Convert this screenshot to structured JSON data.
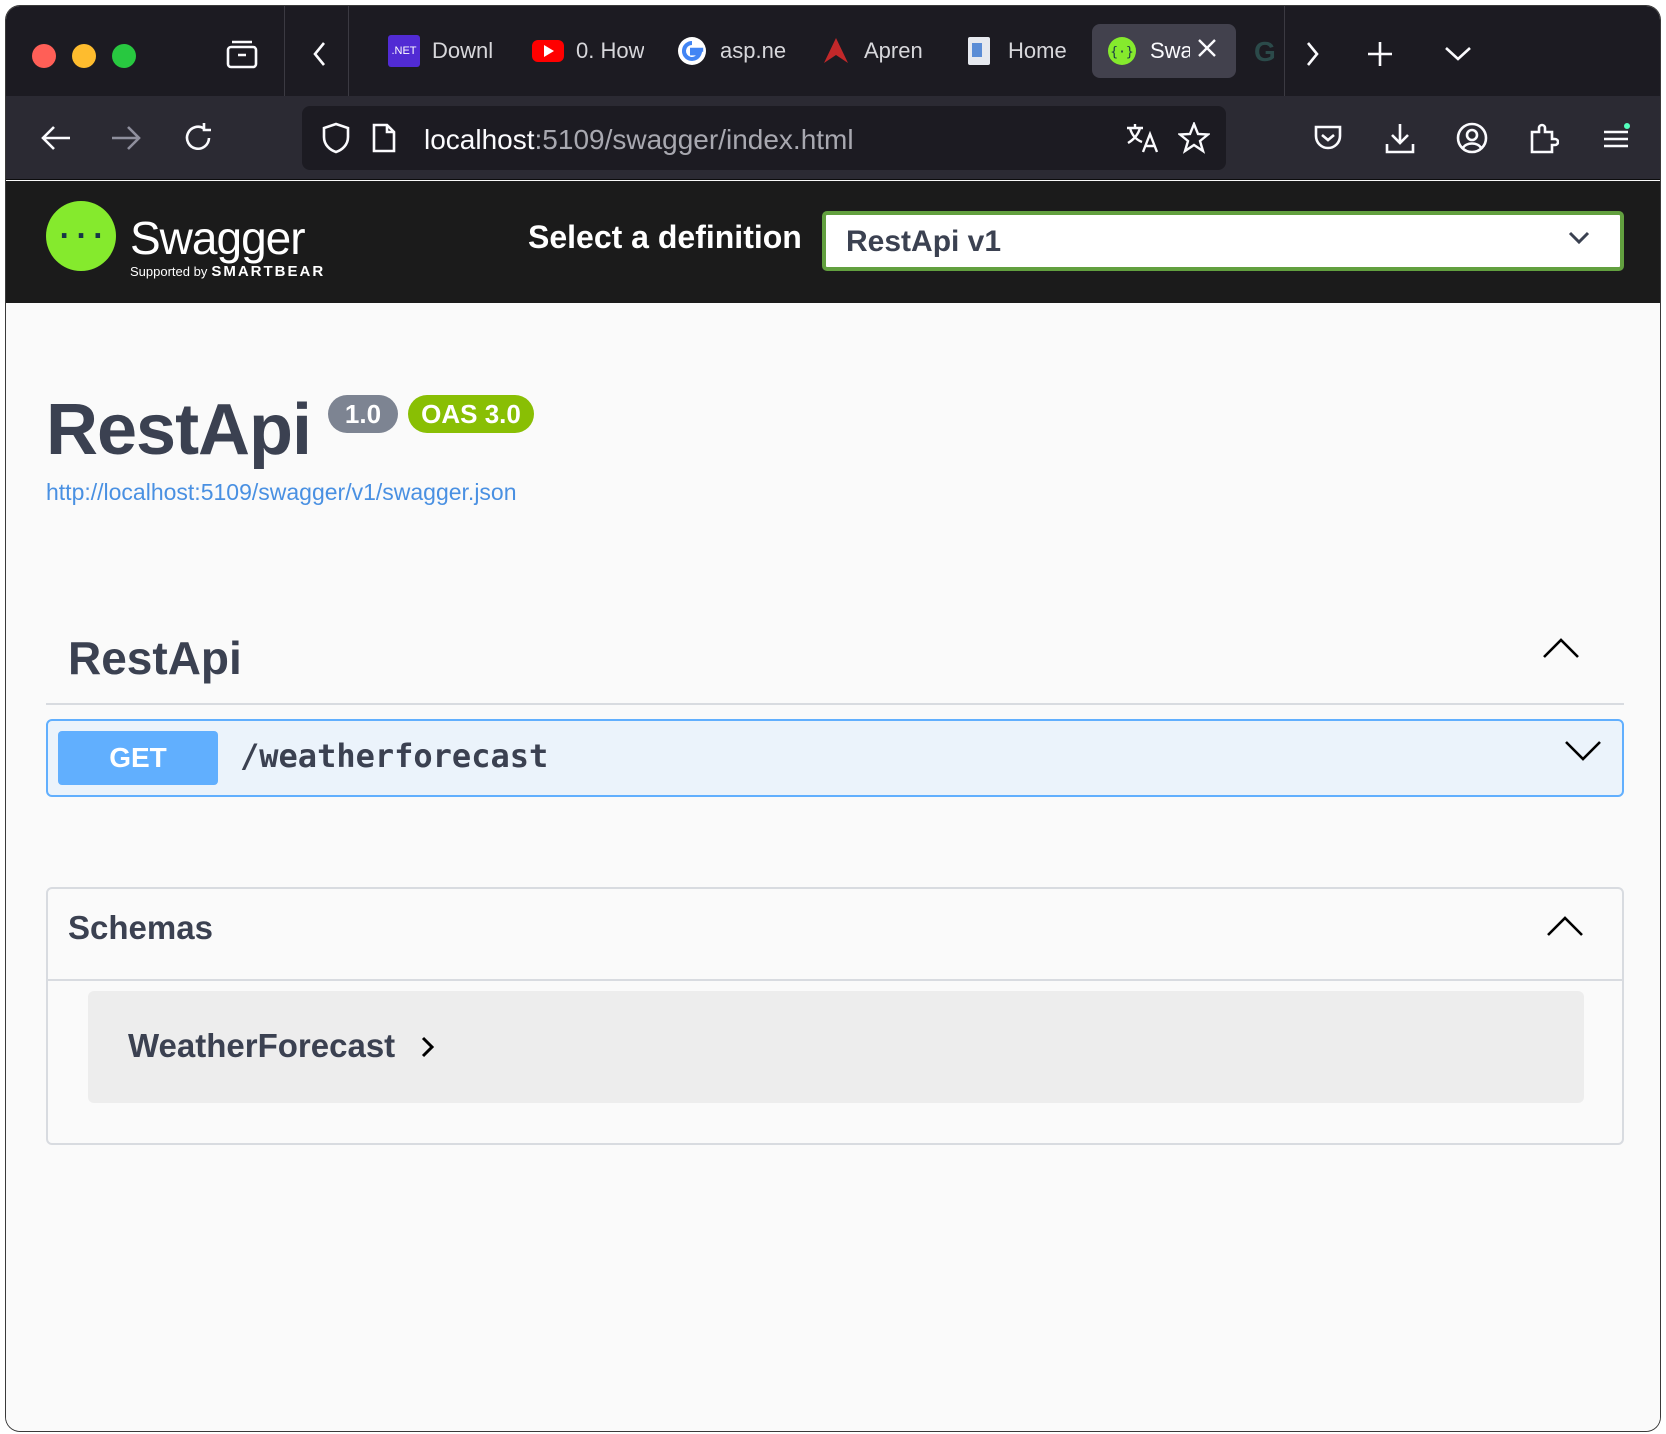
{
  "browser": {
    "tabs": [
      {
        "label": "Downl",
        "icon": "dotnet-icon",
        "active": false
      },
      {
        "label": "0. How",
        "icon": "youtube-icon",
        "active": false
      },
      {
        "label": "asp.ne",
        "icon": "google-icon",
        "active": false
      },
      {
        "label": "Apren",
        "icon": "ms-learn-icon",
        "active": false
      },
      {
        "label": "Home",
        "icon": "document-icon",
        "active": false
      },
      {
        "label": "Swa",
        "icon": "swagger-icon",
        "active": true
      }
    ],
    "dotnet_badge": ".NET",
    "url_host": "localhost",
    "url_rest": ":5109/swagger/index.html"
  },
  "swagger": {
    "brand": "Swagger",
    "supported_by": "Supported by",
    "smartbear": "SMARTBEAR",
    "select_definition_label": "Select a definition",
    "selected_definition": "RestApi v1"
  },
  "info": {
    "title": "RestApi",
    "version": "1.0",
    "oas": "OAS 3.0",
    "spec_url": "http://localhost:5109/swagger/v1/swagger.json"
  },
  "tag": {
    "name": "RestApi",
    "expanded": true
  },
  "operations": [
    {
      "method": "GET",
      "path": "/weatherforecast",
      "color": "#61affe"
    }
  ],
  "schemas": {
    "title": "Schemas",
    "models": [
      "WeatherForecast"
    ]
  },
  "colors": {
    "swagger_green": "#85ea2d",
    "get_blue": "#61affe",
    "oas_green": "#89bf04",
    "version_gray": "#7d8492",
    "link_blue": "#4990e2",
    "select_border": "#62a03f"
  }
}
